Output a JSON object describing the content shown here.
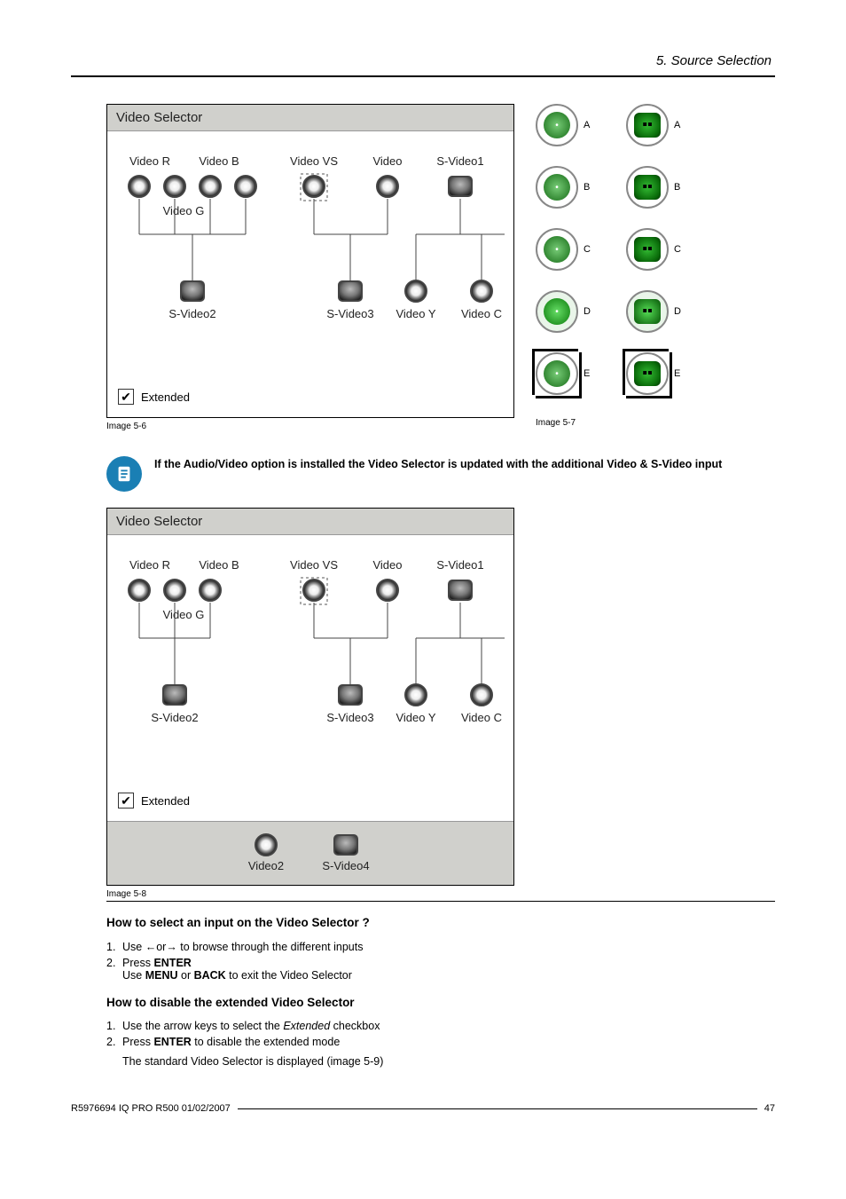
{
  "header": {
    "section": "5.  Source Selection"
  },
  "figure1": {
    "caption": "Image 5-6",
    "title": "Video Selector",
    "labels": {
      "videoR": "Video R",
      "videoG": "Video G",
      "videoB": "Video B",
      "videoVS": "Video VS",
      "video": "Video",
      "svideo1": "S-Video1",
      "svideo2": "S-Video2",
      "svideo3": "S-Video3",
      "videoY": "Video Y",
      "videoC": "Video C"
    },
    "extended_label": "Extended",
    "extended_checked": true
  },
  "figure_icons": {
    "caption": "Image 5-7",
    "letters": [
      "A",
      "B",
      "C",
      "D",
      "E"
    ]
  },
  "note": {
    "text": "If the Audio/Video option is installed the Video Selector is updated with the additional Video & S-Video input"
  },
  "figure2": {
    "caption": "Image 5-8",
    "title": "Video Selector",
    "labels": {
      "videoR": "Video R",
      "videoG": "Video G",
      "videoB": "Video B",
      "videoVS": "Video VS",
      "video": "Video",
      "svideo1": "S-Video1",
      "svideo2": "S-Video2",
      "svideo3": "S-Video3",
      "videoY": "Video Y",
      "videoC": "Video C",
      "video2": "Video2",
      "svideo4": "S-Video4"
    },
    "extended_label": "Extended",
    "extended_checked": true
  },
  "howto1": {
    "heading": "How to select an input on the Video Selector ?",
    "steps": [
      {
        "n": "1.",
        "text_pre": "Use ←or→ to browse through the different inputs"
      },
      {
        "n": "2.",
        "text_pre": "Press ",
        "bold1": "ENTER",
        "line2_pre": "Use ",
        "bold2a": "MENU",
        "line2_mid": " or ",
        "bold2b": "BACK",
        "line2_post": " to exit the Video Selector"
      }
    ]
  },
  "howto2": {
    "heading": "How to disable the extended Video Selector",
    "steps": [
      {
        "n": "1.",
        "text_pre": "Use the arrow keys to select the ",
        "italic": "Extended",
        "text_post": " checkbox"
      },
      {
        "n": "2.",
        "text_pre": "Press ",
        "bold1": "ENTER",
        "text_post": " to disable the extended mode",
        "line2": "The standard Video Selector is displayed (image 5-9)"
      }
    ]
  },
  "footer": {
    "doc": "R5976694  IQ PRO R500  01/02/2007",
    "page": "47"
  }
}
